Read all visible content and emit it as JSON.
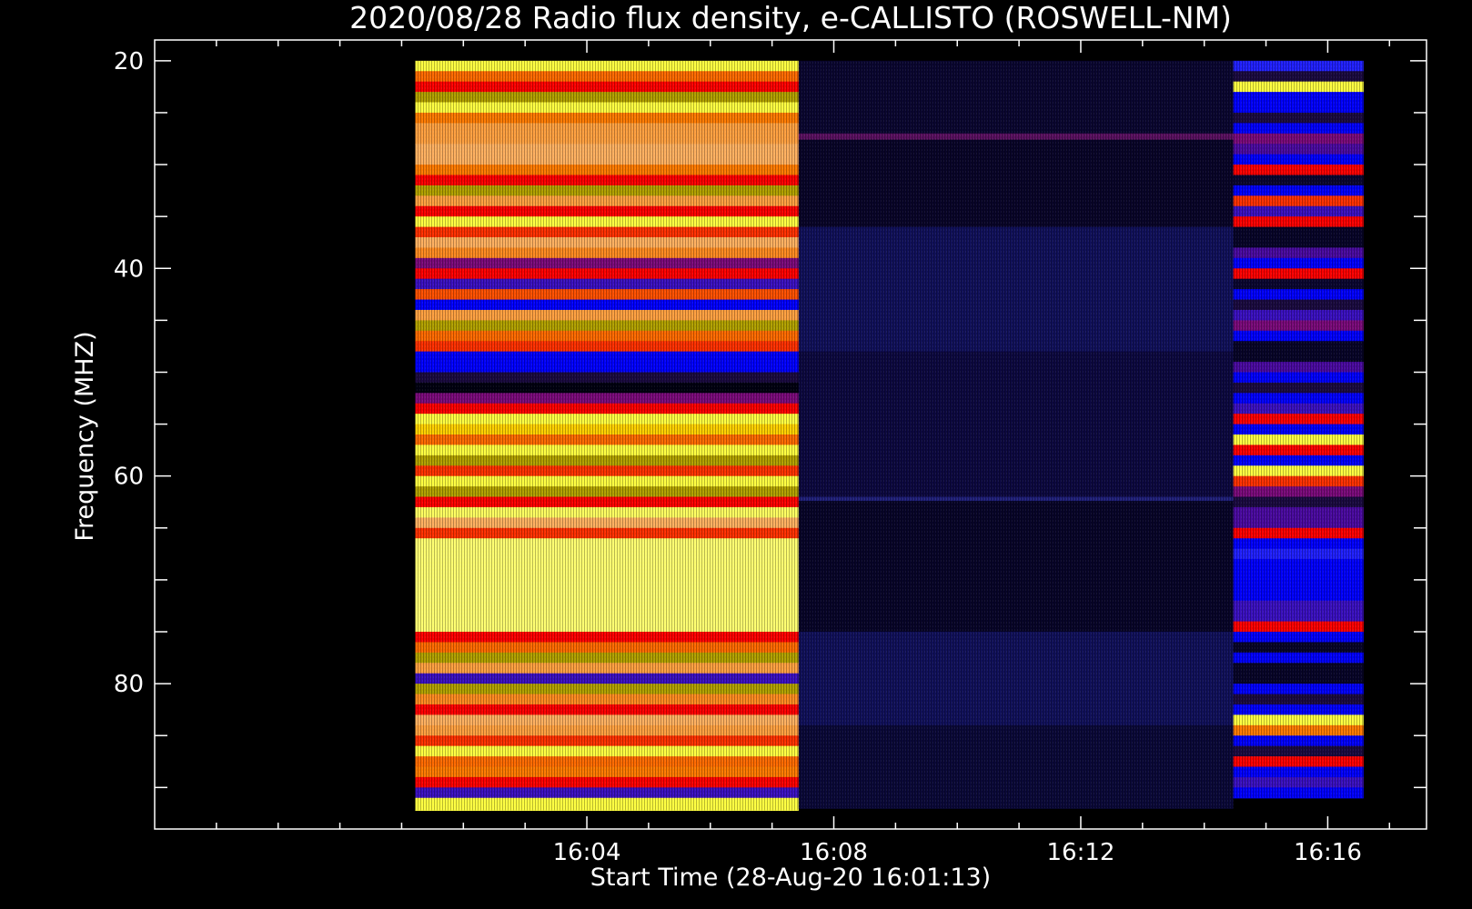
{
  "chart_data": {
    "type": "heatmap",
    "title": "2020/08/28  Radio flux density, e-CALLISTO (ROSWELL-NM)",
    "xlabel": "Start Time (28-Aug-20 16:01:13)",
    "ylabel": "Frequency (MHZ)",
    "x_unit": "minutes after 16:00 UT",
    "xlim": [
      -3.0,
      17.6
    ],
    "ylim": [
      18,
      94
    ],
    "y_inverted": true,
    "x_ticks": [
      {
        "value": 4,
        "label": "16:04"
      },
      {
        "value": 8,
        "label": "16:08"
      },
      {
        "value": 12,
        "label": "16:12"
      },
      {
        "value": 16,
        "label": "16:16"
      }
    ],
    "y_ticks": [
      {
        "value": 20,
        "label": "20"
      },
      {
        "value": 40,
        "label": "40"
      },
      {
        "value": 60,
        "label": "60"
      },
      {
        "value": 80,
        "label": "80"
      }
    ],
    "colormap": [
      "#000000",
      "#1a0a40",
      "#0000ff",
      "#6a0a7a",
      "#ff0000",
      "#ff7a00",
      "#b0a000",
      "#ffff60",
      "#ffffb0"
    ],
    "background": "#000000",
    "blocks": [
      {
        "t_start": 1.22,
        "t_end": 7.43,
        "f_start": 20,
        "f_end": 92.2,
        "bands": [
          {
            "f": [
              20,
              21
            ],
            "color": "#ffff40"
          },
          {
            "f": [
              21,
              22
            ],
            "color": "#ff6a00"
          },
          {
            "f": [
              22,
              23
            ],
            "color": "#ff0000"
          },
          {
            "f": [
              23,
              24
            ],
            "color": "#b0a000"
          },
          {
            "f": [
              24,
              25
            ],
            "color": "#ffff40"
          },
          {
            "f": [
              25,
              26
            ],
            "color": "#ff7a00"
          },
          {
            "f": [
              26,
              28
            ],
            "color": "#ffa040"
          },
          {
            "f": [
              28,
              30
            ],
            "color": "#ffb060"
          },
          {
            "f": [
              30,
              31
            ],
            "color": "#ff7a00"
          },
          {
            "f": [
              31,
              32
            ],
            "color": "#ff0000"
          },
          {
            "f": [
              32,
              33
            ],
            "color": "#b0a000"
          },
          {
            "f": [
              33,
              34
            ],
            "color": "#ffa040"
          },
          {
            "f": [
              34,
              35
            ],
            "color": "#ff0000"
          },
          {
            "f": [
              35,
              36
            ],
            "color": "#ffff40"
          },
          {
            "f": [
              36,
              37
            ],
            "color": "#ff3000"
          },
          {
            "f": [
              37,
              38
            ],
            "color": "#ffb060"
          },
          {
            "f": [
              38,
              39
            ],
            "color": "#ff8a20"
          },
          {
            "f": [
              39,
              40
            ],
            "color": "#7a0a7a"
          },
          {
            "f": [
              40,
              41
            ],
            "color": "#ff0000"
          },
          {
            "f": [
              41,
              42
            ],
            "color": "#3a10c0"
          },
          {
            "f": [
              42,
              43
            ],
            "color": "#ff5000"
          },
          {
            "f": [
              43,
              44
            ],
            "color": "#0000ff"
          },
          {
            "f": [
              44,
              45
            ],
            "color": "#ffa040"
          },
          {
            "f": [
              45,
              46
            ],
            "color": "#b0a000"
          },
          {
            "f": [
              46,
              47
            ],
            "color": "#ff6a00"
          },
          {
            "f": [
              47,
              48
            ],
            "color": "#ff3000"
          },
          {
            "f": [
              48,
              50
            ],
            "color": "#0000ff"
          },
          {
            "f": [
              50,
              51
            ],
            "color": "#1a0a40"
          },
          {
            "f": [
              51,
              52
            ],
            "color": "#000010"
          },
          {
            "f": [
              52,
              53
            ],
            "color": "#7a0a7a"
          },
          {
            "f": [
              53,
              54
            ],
            "color": "#ff0000"
          },
          {
            "f": [
              54,
              55
            ],
            "color": "#ffff40"
          },
          {
            "f": [
              55,
              56
            ],
            "color": "#ffd000"
          },
          {
            "f": [
              56,
              57
            ],
            "color": "#ff6a00"
          },
          {
            "f": [
              57,
              58
            ],
            "color": "#ffff40"
          },
          {
            "f": [
              58,
              59
            ],
            "color": "#b0a000"
          },
          {
            "f": [
              59,
              60
            ],
            "color": "#ff3000"
          },
          {
            "f": [
              60,
              61
            ],
            "color": "#ffff40"
          },
          {
            "f": [
              61,
              62
            ],
            "color": "#b0a000"
          },
          {
            "f": [
              62,
              63
            ],
            "color": "#ff0000"
          },
          {
            "f": [
              63,
              64
            ],
            "color": "#ffff60"
          },
          {
            "f": [
              64,
              65
            ],
            "color": "#ffb060"
          },
          {
            "f": [
              65,
              66
            ],
            "color": "#ff3000"
          },
          {
            "f": [
              66,
              75
            ],
            "color": "#ffff70"
          },
          {
            "f": [
              75,
              76
            ],
            "color": "#ff0000"
          },
          {
            "f": [
              76,
              77
            ],
            "color": "#ff6a00"
          },
          {
            "f": [
              77,
              78
            ],
            "color": "#b0a000"
          },
          {
            "f": [
              78,
              79
            ],
            "color": "#ffa040"
          },
          {
            "f": [
              79,
              80
            ],
            "color": "#3a10c0"
          },
          {
            "f": [
              80,
              81
            ],
            "color": "#b0a000"
          },
          {
            "f": [
              81,
              82
            ],
            "color": "#ff8a20"
          },
          {
            "f": [
              82,
              83
            ],
            "color": "#ff0000"
          },
          {
            "f": [
              83,
              84
            ],
            "color": "#ffb060"
          },
          {
            "f": [
              84,
              85
            ],
            "color": "#ffa040"
          },
          {
            "f": [
              85,
              86
            ],
            "color": "#ff3000"
          },
          {
            "f": [
              86,
              87
            ],
            "color": "#ffff40"
          },
          {
            "f": [
              87,
              88
            ],
            "color": "#ff6a00"
          },
          {
            "f": [
              88,
              89
            ],
            "color": "#ff7a00"
          },
          {
            "f": [
              89,
              90
            ],
            "color": "#ff0000"
          },
          {
            "f": [
              90,
              91
            ],
            "color": "#3a10c0"
          },
          {
            "f": [
              91,
              92.2
            ],
            "color": "#ffff40"
          }
        ]
      },
      {
        "t_start": 7.43,
        "t_end": 14.47,
        "f_start": 20,
        "f_end": 92,
        "bands": [
          {
            "f": [
              20,
              27
            ],
            "color": "#0a0630"
          },
          {
            "f": [
              27,
              27.6
            ],
            "color": "#5a1060"
          },
          {
            "f": [
              27.6,
              36
            ],
            "color": "#080428"
          },
          {
            "f": [
              36,
              48
            ],
            "color": "#10105a"
          },
          {
            "f": [
              48,
              62
            ],
            "color": "#0c0840"
          },
          {
            "f": [
              62,
              62.4
            ],
            "color": "#20207a"
          },
          {
            "f": [
              62.4,
              75
            ],
            "color": "#070428"
          },
          {
            "f": [
              75,
              84
            ],
            "color": "#10105a"
          },
          {
            "f": [
              84,
              92
            ],
            "color": "#0a0838"
          }
        ]
      },
      {
        "t_start": 14.47,
        "t_end": 16.58,
        "f_start": 20,
        "f_end": 91,
        "bands": [
          {
            "f": [
              20,
              21
            ],
            "color": "#2020ff"
          },
          {
            "f": [
              21,
              22
            ],
            "color": "#1a0a40"
          },
          {
            "f": [
              22,
              23
            ],
            "color": "#ffff40"
          },
          {
            "f": [
              23,
              25
            ],
            "color": "#0000ff"
          },
          {
            "f": [
              25,
              26
            ],
            "color": "#1a0a40"
          },
          {
            "f": [
              26,
              27
            ],
            "color": "#0000ff"
          },
          {
            "f": [
              27,
              28
            ],
            "color": "#7a0a7a"
          },
          {
            "f": [
              28,
              29
            ],
            "color": "#4a0aa0"
          },
          {
            "f": [
              29,
              30
            ],
            "color": "#0000ff"
          },
          {
            "f": [
              30,
              31
            ],
            "color": "#ff0000"
          },
          {
            "f": [
              31,
              32
            ],
            "color": "#0a0630"
          },
          {
            "f": [
              32,
              33
            ],
            "color": "#0000ff"
          },
          {
            "f": [
              33,
              34
            ],
            "color": "#ff3000"
          },
          {
            "f": [
              34,
              35
            ],
            "color": "#3a10c0"
          },
          {
            "f": [
              35,
              36
            ],
            "color": "#ff0000"
          },
          {
            "f": [
              36,
              38
            ],
            "color": "#070428"
          },
          {
            "f": [
              38,
              39
            ],
            "color": "#4a0aa0"
          },
          {
            "f": [
              39,
              40
            ],
            "color": "#0000ff"
          },
          {
            "f": [
              40,
              41
            ],
            "color": "#ff0000"
          },
          {
            "f": [
              41,
              42
            ],
            "color": "#0a0630"
          },
          {
            "f": [
              42,
              43
            ],
            "color": "#0000ff"
          },
          {
            "f": [
              43,
              44
            ],
            "color": "#1a0a40"
          },
          {
            "f": [
              44,
              45
            ],
            "color": "#3a10c0"
          },
          {
            "f": [
              45,
              46
            ],
            "color": "#7a0a7a"
          },
          {
            "f": [
              46,
              47
            ],
            "color": "#0000ff"
          },
          {
            "f": [
              47,
              49
            ],
            "color": "#070428"
          },
          {
            "f": [
              49,
              50
            ],
            "color": "#4a0aa0"
          },
          {
            "f": [
              50,
              51
            ],
            "color": "#0000ff"
          },
          {
            "f": [
              51,
              52
            ],
            "color": "#1a0a40"
          },
          {
            "f": [
              52,
              53
            ],
            "color": "#0000ff"
          },
          {
            "f": [
              53,
              54
            ],
            "color": "#3a10c0"
          },
          {
            "f": [
              54,
              55
            ],
            "color": "#ff0000"
          },
          {
            "f": [
              55,
              56
            ],
            "color": "#0000ff"
          },
          {
            "f": [
              56,
              57
            ],
            "color": "#ffff40"
          },
          {
            "f": [
              57,
              58
            ],
            "color": "#ff0000"
          },
          {
            "f": [
              58,
              59
            ],
            "color": "#0000ff"
          },
          {
            "f": [
              59,
              60
            ],
            "color": "#ffff40"
          },
          {
            "f": [
              60,
              61
            ],
            "color": "#ff3000"
          },
          {
            "f": [
              61,
              62
            ],
            "color": "#7a0a7a"
          },
          {
            "f": [
              62,
              63
            ],
            "color": "#1a0a40"
          },
          {
            "f": [
              63,
              65
            ],
            "color": "#4a0aa0"
          },
          {
            "f": [
              65,
              66
            ],
            "color": "#ff0000"
          },
          {
            "f": [
              66,
              67
            ],
            "color": "#0000ff"
          },
          {
            "f": [
              67,
              68
            ],
            "color": "#2020ff"
          },
          {
            "f": [
              68,
              72
            ],
            "color": "#0000ff"
          },
          {
            "f": [
              72,
              74
            ],
            "color": "#3a10c0"
          },
          {
            "f": [
              74,
              75
            ],
            "color": "#ff0000"
          },
          {
            "f": [
              75,
              76
            ],
            "color": "#0000ff"
          },
          {
            "f": [
              76,
              77
            ],
            "color": "#070428"
          },
          {
            "f": [
              77,
              78
            ],
            "color": "#0000ff"
          },
          {
            "f": [
              78,
              80
            ],
            "color": "#070428"
          },
          {
            "f": [
              80,
              81
            ],
            "color": "#0000ff"
          },
          {
            "f": [
              81,
              82
            ],
            "color": "#1a0a40"
          },
          {
            "f": [
              82,
              83
            ],
            "color": "#0000ff"
          },
          {
            "f": [
              83,
              84
            ],
            "color": "#ffff40"
          },
          {
            "f": [
              84,
              85
            ],
            "color": "#ff7a00"
          },
          {
            "f": [
              85,
              86
            ],
            "color": "#0000ff"
          },
          {
            "f": [
              86,
              87
            ],
            "color": "#1a0a40"
          },
          {
            "f": [
              87,
              88
            ],
            "color": "#ff0000"
          },
          {
            "f": [
              88,
              89
            ],
            "color": "#0000ff"
          },
          {
            "f": [
              89,
              90
            ],
            "color": "#3a10c0"
          },
          {
            "f": [
              90,
              91
            ],
            "color": "#0000ff"
          }
        ]
      }
    ]
  }
}
